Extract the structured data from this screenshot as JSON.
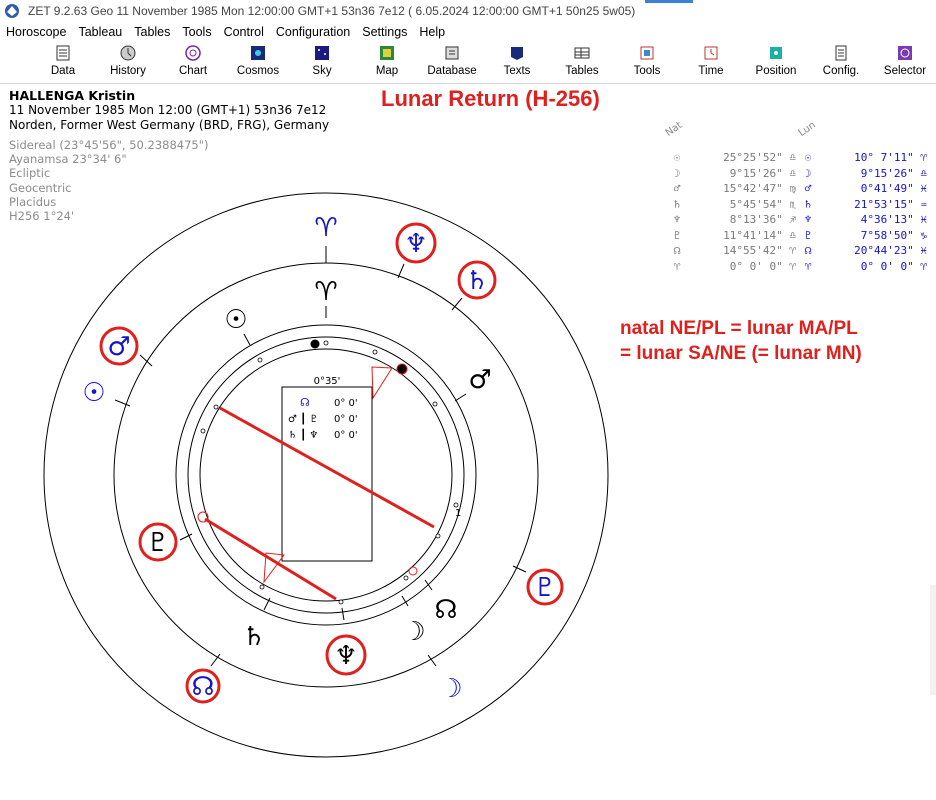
{
  "window": {
    "title": "ZET 9.2.63 Geo   11 November 1985  Mon  12:00:00 GMT+1 53n36  7e12  ( 6.05.2024  12:00:00 GMT+1 50n25 5w05)"
  },
  "menu": [
    "Horoscope",
    "Tableau",
    "Tables",
    "Tools",
    "Control",
    "Configuration",
    "Settings",
    "Help"
  ],
  "toolbar": [
    {
      "label": "Data",
      "icon": "data-icon"
    },
    {
      "label": "History",
      "icon": "history-icon"
    },
    {
      "label": "Chart",
      "icon": "chart-icon"
    },
    {
      "label": "Cosmos",
      "icon": "cosmos-icon"
    },
    {
      "label": "Sky",
      "icon": "sky-icon"
    },
    {
      "label": "Map",
      "icon": "map-icon"
    },
    {
      "label": "Database",
      "icon": "database-icon"
    },
    {
      "label": "Texts",
      "icon": "texts-icon"
    },
    {
      "label": "Tables",
      "icon": "tables-icon"
    },
    {
      "label": "Tools",
      "icon": "tools-icon"
    },
    {
      "label": "Time",
      "icon": "time-icon"
    },
    {
      "label": "Position",
      "icon": "position-icon"
    },
    {
      "label": "Config.",
      "icon": "config-icon"
    },
    {
      "label": "Selector",
      "icon": "selector-icon"
    }
  ],
  "header": {
    "name": "HALLENGA Kristin",
    "date_line": "11 November 1985  Mon  12:00 (GMT+1) 53n36  7e12",
    "place": "Norden, Former West Germany (BRD, FRG), Germany",
    "settings": [
      "Sidereal (23°45'56\", 50.2388475\")",
      "Ayanamsa 23°34' 6\"",
      "Ecliptic",
      "Geocentric",
      "Placidus",
      "H256   1°24'"
    ]
  },
  "title": "Lunar Return (H-256)",
  "annotation": [
    "natal NE/PL = lunar MA/PL",
    "= lunar SA/NE (= lunar MN)"
  ],
  "tables": {
    "natal_header": "Nat",
    "lunar_header": "Lun",
    "natal": [
      {
        "glyph": "☉",
        "value": "25°25'52\" ♎"
      },
      {
        "glyph": "☽",
        "value": "9°15'26\" ♎"
      },
      {
        "glyph": "♂",
        "value": "15°42'47\" ♍"
      },
      {
        "glyph": "♄",
        "value": "5°45'54\" ♏"
      },
      {
        "glyph": "♆",
        "value": "8°13'36\" ♐"
      },
      {
        "glyph": "♇",
        "value": "11°41'14\" ♎"
      },
      {
        "glyph": "☊",
        "value": "14°55'42\" ♈"
      },
      {
        "glyph": "♈",
        "value": "0° 0' 0\" ♈"
      }
    ],
    "lunar": [
      {
        "glyph": "☉",
        "value": "10° 7'11\" ♈"
      },
      {
        "glyph": "☽",
        "value": "9°15'26\" ♎"
      },
      {
        "glyph": "♂",
        "value": "0°41'49\" ♓"
      },
      {
        "glyph": "♄",
        "value": "21°53'15\" ♒"
      },
      {
        "glyph": "♆",
        "value": "4°36'13\" ♓"
      },
      {
        "glyph": "♇",
        "value": "7°58'50\" ♑"
      },
      {
        "glyph": "☊",
        "value": "20°44'23\" ♓"
      },
      {
        "glyph": "♈",
        "value": "0° 0' 0\" ♈"
      }
    ]
  },
  "chart": {
    "center_label": "0°35'",
    "aspect_rows": [
      {
        "left": "☊",
        "value": "0° 0'"
      },
      {
        "left": "♂ ┃ ♇",
        "value": "0° 0'"
      },
      {
        "left": "♄ ┃ ♆",
        "value": "0° 0'"
      }
    ],
    "cusp_label": "1",
    "outer_glyphs": [
      {
        "glyph": "♈",
        "color": "#1414c8",
        "circled": false
      },
      {
        "glyph": "♆",
        "color": "#1414c8",
        "circled": true
      },
      {
        "glyph": "♄",
        "color": "#1414c8",
        "circled": true
      },
      {
        "glyph": "♂",
        "color": "#1414c8",
        "circled": true
      },
      {
        "glyph": "☉",
        "color": "#1414c8",
        "circled": false
      },
      {
        "glyph": "♇",
        "color": "#1414c8",
        "circled": true
      },
      {
        "glyph": "☽",
        "color": "#1414c8",
        "circled": false
      },
      {
        "glyph": "☊",
        "color": "#1414c8",
        "circled": true
      }
    ],
    "inner_glyphs": [
      {
        "glyph": "♈",
        "color": "#000000",
        "circled": false
      },
      {
        "glyph": "☉",
        "color": "#000000",
        "circled": false
      },
      {
        "glyph": "♂",
        "color": "#000000",
        "circled": false
      },
      {
        "glyph": "♇",
        "color": "#000000",
        "circled": true
      },
      {
        "glyph": "♄",
        "color": "#000000",
        "circled": false
      },
      {
        "glyph": "♆",
        "color": "#000000",
        "circled": true
      },
      {
        "glyph": "☽",
        "color": "#000000",
        "circled": false
      },
      {
        "glyph": "☊",
        "color": "#000000",
        "circled": false
      }
    ],
    "colors": {
      "accent": "#e0201c",
      "lunar": "#1414c8",
      "natal": "#000000",
      "faded": "#8c8c8c"
    }
  }
}
